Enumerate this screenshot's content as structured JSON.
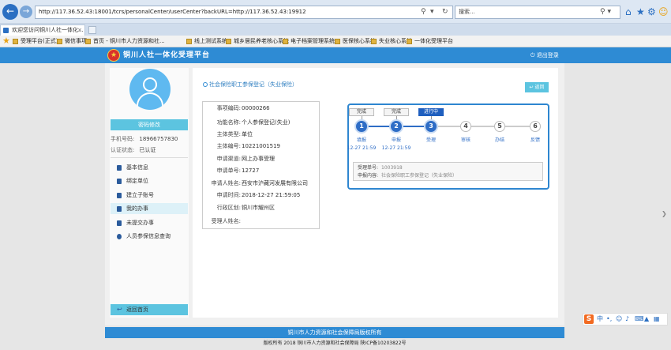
{
  "browser": {
    "url": "http://117.36.52.43:18001/tcrs/personalCenter/userCenter?backURL=http://117.36.52.43:19912",
    "search_placeholder": "搜索...",
    "tab_title": "欢迎您访问铜川人社一体化...",
    "favorites": [
      "受理平台(正式)",
      "微信事项",
      "首页 - 铜川市人力资源和社...",
      "线上测试系统",
      "城乡居民养老核心系统",
      "电子档案管理系统",
      "医保核心系统",
      "失业核心系统",
      "一体化受理平台"
    ]
  },
  "header": {
    "title": "铜川人社一体化受理平台",
    "logout": "退出登录"
  },
  "sidebar": {
    "change_password": "密码修改",
    "phone_label": "手机号码:",
    "phone_value": "18966757830",
    "auth_label": "认证状态:",
    "auth_value": "已认证",
    "menu": [
      "基本信息",
      "绑定单位",
      "建立子账号",
      "我的办事",
      "未提交办事",
      "人员参保信息查询"
    ],
    "back_home": "返回首页"
  },
  "content": {
    "breadcrumb": "社会保险职工参保登记（失业保险）",
    "return_label": "返回",
    "details": [
      {
        "k": "事项编码:",
        "v": "00000266"
      },
      {
        "k": "功能名称:",
        "v": "个人参保登记(失业)"
      },
      {
        "k": "主体类型:",
        "v": "单位"
      },
      {
        "k": "主体编号:",
        "v": "10221001519"
      },
      {
        "k": "申请渠道:",
        "v": "网上办事受理"
      },
      {
        "k": "申请单号:",
        "v": "12727"
      },
      {
        "k": "申请人姓名:",
        "v": "西安市沪藏河发展有限公司"
      },
      {
        "k": "申请时间:",
        "v": "2018-12-27 21:59:05"
      },
      {
        "k": "行政区划:",
        "v": "铜川市耀州区"
      },
      {
        "k": "受理人姓名:",
        "v": ""
      }
    ],
    "progress": {
      "steps": [
        {
          "num": "1",
          "label": "填报",
          "time": "12-27 21:59",
          "flag": "完成"
        },
        {
          "num": "2",
          "label": "申报",
          "time": "12-27 21:59",
          "flag": "完成"
        },
        {
          "num": "3",
          "label": "受理",
          "time": "",
          "flag": "进行中"
        },
        {
          "num": "4",
          "label": "审核",
          "time": "",
          "flag": ""
        },
        {
          "num": "5",
          "label": "办结",
          "time": "",
          "flag": ""
        },
        {
          "num": "6",
          "label": "反馈",
          "time": "",
          "flag": ""
        }
      ],
      "accept_no_label": "受理单号:",
      "accept_no_value": "1003918",
      "apply_content_label": "申报内容:",
      "apply_content_value": "社会保险职工参保登记（失业保险）"
    }
  },
  "footer": {
    "line1": "铜川市人力资源和社会保障局版权所有",
    "line2": "版权所有 2018 铜川市人力资源和社会保障局 陕ICP备10203822号"
  },
  "ime": {
    "logo": "S",
    "lang": "中"
  },
  "colors": {
    "header": "#2e8bd4",
    "accent": "#5cc4e0",
    "step_done": "#2e6dc6"
  }
}
